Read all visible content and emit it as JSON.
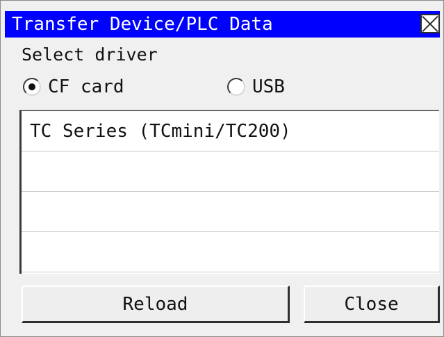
{
  "window": {
    "title": "Transfer Device/PLC Data",
    "title_bg": "#0000ff",
    "close_icon": "close-x-icon"
  },
  "driver": {
    "label": "Select driver",
    "options": [
      {
        "label": "CF card",
        "checked": true
      },
      {
        "label": "USB",
        "checked": false
      }
    ]
  },
  "list": {
    "rows": [
      "TC Series (TCmini/TC200)",
      "",
      "",
      ""
    ]
  },
  "buttons": {
    "reload": "Reload",
    "close": "Close"
  }
}
